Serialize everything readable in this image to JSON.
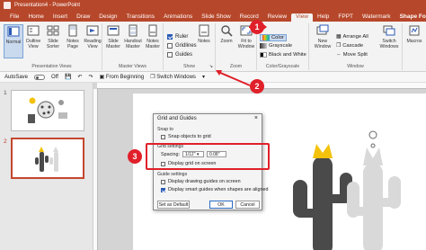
{
  "window": {
    "title": "Presentation4 - PowerPoint"
  },
  "tabs": [
    "File",
    "Home",
    "Insert",
    "Draw",
    "Design",
    "Transitions",
    "Animations",
    "Slide Show",
    "Record",
    "Review",
    "View",
    "Help",
    "FPPT",
    "Watermark",
    "Shape Format"
  ],
  "active_tab": "View",
  "ribbon": {
    "presentation_views": {
      "label": "Presentation Views",
      "buttons": [
        "Normal",
        "Outline View",
        "Slide Sorter",
        "Notes Page",
        "Reading View"
      ]
    },
    "master_views": {
      "label": "Master Views",
      "buttons": [
        "Slide Master",
        "Handout Master",
        "Notes Master"
      ]
    },
    "show": {
      "label": "Show",
      "items": [
        {
          "label": "Ruler",
          "checked": true
        },
        {
          "label": "Gridlines",
          "checked": false
        },
        {
          "label": "Guides",
          "checked": false
        }
      ],
      "notes_label": "Notes"
    },
    "zoom": {
      "label": "Zoom",
      "buttons": [
        "Zoom",
        "Fit to Window"
      ]
    },
    "color": {
      "label": "Color/Grayscale",
      "items": [
        "Color",
        "Grayscale",
        "Black and White"
      ]
    },
    "window": {
      "label": "Window",
      "new_window": "New Window",
      "items": [
        "Arrange All",
        "Cascade",
        "Move Split"
      ],
      "switch": "Switch Windows"
    },
    "macros": {
      "label": "Macros"
    }
  },
  "qat": {
    "autosave": "AutoSave",
    "toggle": "Off",
    "from_beginning": "From Beginning",
    "switch_windows": "Switch Windows"
  },
  "thumbnails": [
    {
      "number": "1"
    },
    {
      "number": "2"
    }
  ],
  "dialog": {
    "title": "Grid and Guides",
    "close": "×",
    "snap_to": "Snap to",
    "snap_objects": "Snap objects to grid",
    "grid_settings": "Grid settings",
    "spacing_label": "Spacing:",
    "spacing_value": "1/12\"",
    "spacing_number": "0.08\"",
    "display_grid": "Display grid on screen",
    "guide_settings": "Guide settings",
    "display_guides": "Display drawing guides on screen",
    "display_smart": "Display smart guides when shapes are aligned",
    "set_default": "Set as Default",
    "ok": "OK",
    "cancel": "Cancel"
  },
  "callouts": [
    "1",
    "2",
    "3"
  ],
  "colors": {
    "accent": "#b7472a",
    "callout": "#e0202a",
    "cactus_dark": "#4a4a4a",
    "cactus_light": "#d9d9d9",
    "flower": "#f4c20d"
  }
}
